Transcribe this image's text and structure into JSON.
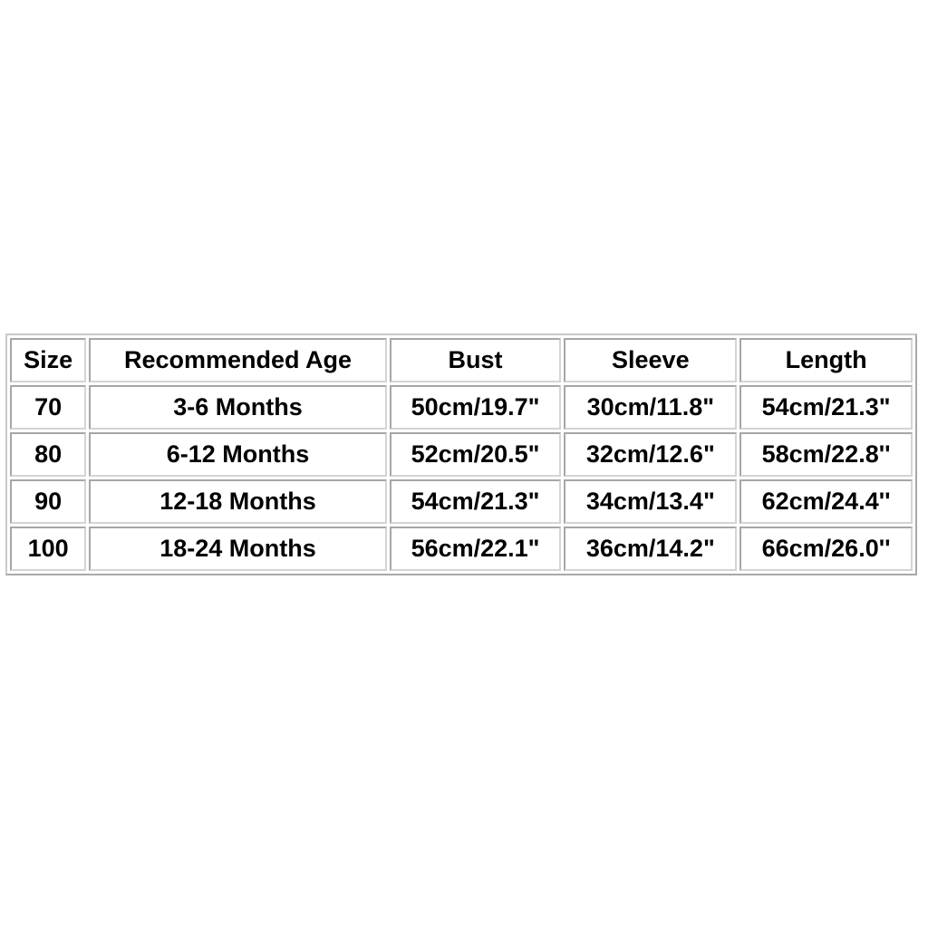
{
  "size_chart": {
    "headers": [
      "Size",
      "Recommended Age",
      "Bust",
      "Sleeve",
      "Length"
    ],
    "rows": [
      [
        "70",
        "3-6 Months",
        "50cm/19.7\"",
        "30cm/11.8\"",
        "54cm/21.3\""
      ],
      [
        "80",
        "6-12 Months",
        "52cm/20.5\"",
        "32cm/12.6\"",
        "58cm/22.8''"
      ],
      [
        "90",
        "12-18 Months",
        "54cm/21.3\"",
        "34cm/13.4\"",
        "62cm/24.4''"
      ],
      [
        "100",
        "18-24 Months",
        "56cm/22.1\"",
        "36cm/14.2\"",
        "66cm/26.0''"
      ]
    ]
  }
}
